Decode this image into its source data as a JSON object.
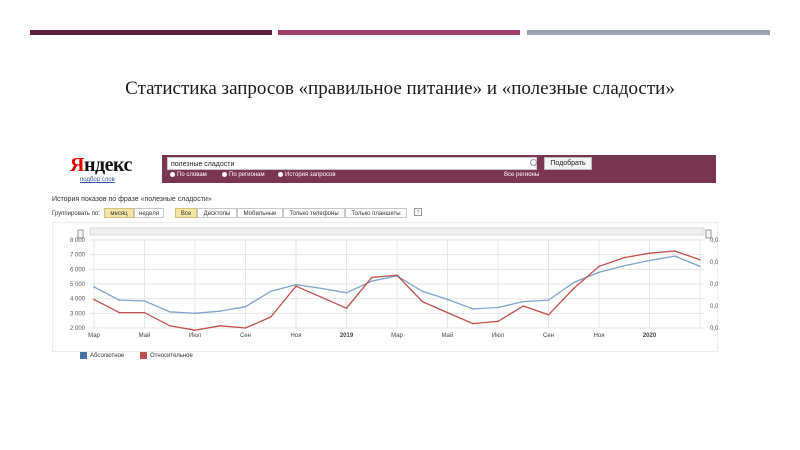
{
  "slide": {
    "title": "Статистика запросов «правильное питание» и «полезные сладости»",
    "bar_colors": [
      "#5b1f3b",
      "#a03d6d",
      "#9aa4b1"
    ]
  },
  "yandex": {
    "logo_first": "Я",
    "logo_rest": "ндекс",
    "sublogo": "подбор слов",
    "search_value": "полезные сладости",
    "search_button": "Подобрать",
    "radio_words": "По словам",
    "radio_regions": "По регионам",
    "radio_history": "История запросов",
    "all_regions": "Все регионы",
    "history_title": "История показов по фразе «полезные сладости»",
    "group_by": "Группировать по:",
    "group_month": "месяц",
    "group_week": "неделя",
    "device_all": "Все",
    "device_desktop": "Десктопы",
    "device_mobile": "Мобильные",
    "device_phones": "Только телефоны",
    "device_tablets": "Только планшеты",
    "help": "?",
    "accent": "#7a3550"
  },
  "chart_data": {
    "type": "line",
    "x": [
      "Мар",
      "",
      "Май",
      "",
      "Июл",
      "",
      "Сен",
      "",
      "Ноя",
      "",
      "2019",
      "",
      "Мар",
      "",
      "Май",
      "",
      "Июл",
      "",
      "Сен",
      "",
      "Ноя",
      "",
      "2020",
      "",
      ""
    ],
    "series": [
      {
        "name": "Абсолютное",
        "color": "#7fa3cc",
        "axis": "left",
        "values": [
          4800,
          3900,
          3850,
          3100,
          3000,
          3150,
          3450,
          4500,
          4950,
          4700,
          4400,
          5200,
          5550,
          4500,
          3950,
          3300,
          3400,
          3800,
          3900,
          5100,
          5800,
          6250,
          6600,
          6900,
          6200
        ]
      },
      {
        "name": "Относительное",
        "color": "#c0504d",
        "axis": "right",
        "values": [
          5.3e-07,
          4.7e-07,
          4.7e-07,
          4.1e-07,
          3.9e-07,
          4.1e-07,
          4e-07,
          4.5e-07,
          5.9e-07,
          5.4e-07,
          4.9e-07,
          6.3e-07,
          6.4e-07,
          5.2e-07,
          4.7e-07,
          4.2e-07,
          4.3e-07,
          5e-07,
          4.6e-07,
          5.8e-07,
          6.8e-07,
          7.2e-07,
          7.4e-07,
          7.5e-07,
          7.1e-07
        ]
      }
    ],
    "y_left_ticks": [
      "8 000",
      "7 000",
      "6 000",
      "5 000",
      "4 000",
      "3 000",
      "2 000"
    ],
    "y_left_range": [
      2000,
      8000
    ],
    "y_right_ticks": [
      "0,000 000 8",
      "0,000 000 7",
      "0,000 000 6",
      "0,000 000 5",
      "0,000 000 4"
    ],
    "y_right_range": [
      4e-07,
      8e-07
    ],
    "grid": true,
    "legend_position": "bottom-left"
  }
}
